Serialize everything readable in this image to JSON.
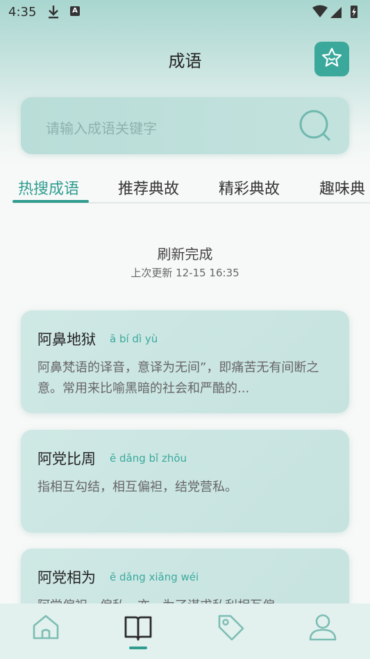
{
  "status_bar": {
    "time": "4:35",
    "a_badge": "A"
  },
  "header": {
    "title": "成语"
  },
  "search": {
    "placeholder": "请输入成语关键字"
  },
  "tabs": [
    {
      "label": "热搜成语",
      "active": true
    },
    {
      "label": "推荐典故",
      "active": false
    },
    {
      "label": "精彩典故",
      "active": false
    },
    {
      "label": "趣味典",
      "active": false
    }
  ],
  "refresh": {
    "title": "刷新完成",
    "subtitle": "上次更新 12-15 16:35"
  },
  "cards": [
    {
      "name": "阿鼻地狱",
      "pinyin": "ā bí dì yù",
      "desc": "阿鼻梵语的译音，意译为无间”，即痛苦无有间断之意。常用来比喻黑暗的社会和严酷的..."
    },
    {
      "name": "阿党比周",
      "pinyin": "ē dǎng bǐ zhōu",
      "desc": "指相互勾结，相互偏袒，结党营私。"
    },
    {
      "name": "阿党相为",
      "pinyin": "ē dǎng xiāng wéi",
      "desc": "阿党偏袒，偏私。亦。为了谋求私利相互偏"
    }
  ],
  "colors": {
    "accent": "#2f9c8f",
    "card_bg": "#c9e4e0",
    "nav_bg": "#e2f1ee"
  },
  "icons": {
    "favorite": "star-icon",
    "search": "search-icon",
    "nav": [
      "home-icon",
      "book-icon",
      "tag-icon",
      "user-icon"
    ]
  },
  "bottom_nav": {
    "active_index": 1
  }
}
